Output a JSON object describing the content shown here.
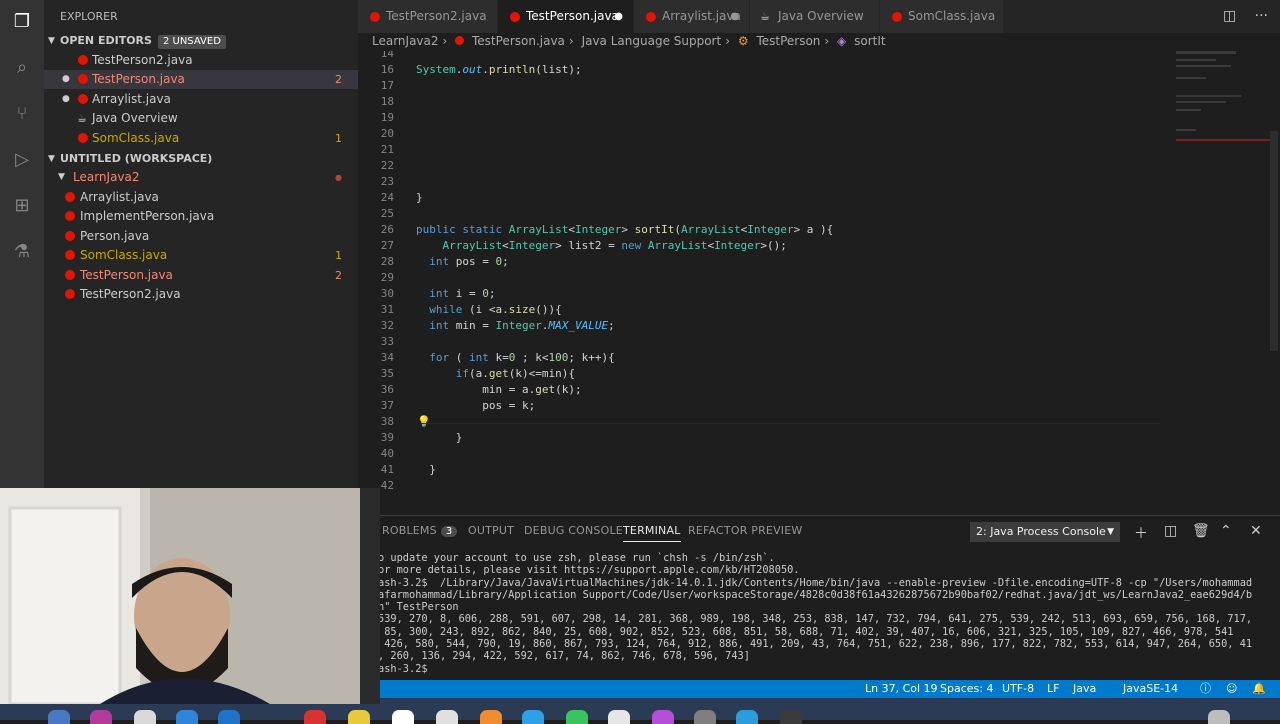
{
  "sidebar": {
    "title": "EXPLORER",
    "open_editors": {
      "label": "OPEN EDITORS",
      "badge": "2 UNSAVED",
      "items": [
        {
          "name": "TestPerson2.java",
          "count": ""
        },
        {
          "name": "TestPerson.java",
          "count": "2"
        },
        {
          "name": "Arraylist.java",
          "count": ""
        },
        {
          "name": "Java Overview",
          "count": ""
        },
        {
          "name": "SomClass.java",
          "count": "1"
        }
      ]
    },
    "workspace": {
      "label": "UNTITLED (WORKSPACE)",
      "folder": "LearnJava2",
      "items": [
        {
          "name": "Arraylist.java",
          "count": ""
        },
        {
          "name": "ImplementPerson.java",
          "count": ""
        },
        {
          "name": "Person.java",
          "count": ""
        },
        {
          "name": "SomClass.java",
          "count": "1"
        },
        {
          "name": "TestPerson.java",
          "count": "2"
        },
        {
          "name": "TestPerson2.java",
          "count": ""
        }
      ]
    }
  },
  "tabs": [
    {
      "label": "TestPerson2.java"
    },
    {
      "label": "TestPerson.java"
    },
    {
      "label": "Arraylist.java"
    },
    {
      "label": "Java Overview"
    },
    {
      "label": "SomClass.java"
    }
  ],
  "breadcrumbs": [
    "LearnJava2",
    "TestPerson.java",
    "Java Language Support",
    "TestPerson",
    "sortIt"
  ],
  "editor": {
    "lines": [
      {
        "n": "14",
        "t": ""
      },
      {
        "n": "16",
        "t": "System.out.println(list);"
      },
      {
        "n": "17",
        "t": ""
      },
      {
        "n": "18",
        "t": ""
      },
      {
        "n": "19",
        "t": ""
      },
      {
        "n": "20",
        "t": ""
      },
      {
        "n": "21",
        "t": ""
      },
      {
        "n": "22",
        "t": ""
      },
      {
        "n": "23",
        "t": ""
      },
      {
        "n": "24",
        "t": "}"
      },
      {
        "n": "25",
        "t": ""
      },
      {
        "n": "26",
        "t": "public static ArrayList<Integer> sortIt(ArrayList<Integer> a ){"
      },
      {
        "n": "27",
        "t": "    ArrayList<Integer> list2 = new ArrayList<Integer>();"
      },
      {
        "n": "28",
        "t": "  int pos = 0;"
      },
      {
        "n": "29",
        "t": ""
      },
      {
        "n": "30",
        "t": "  int i = 0;"
      },
      {
        "n": "31",
        "t": "  while (i <a.size()){"
      },
      {
        "n": "32",
        "t": "  int min = Integer.MAX_VALUE;"
      },
      {
        "n": "33",
        "t": ""
      },
      {
        "n": "34",
        "t": "  for ( int k=0 ; k<100; k++){"
      },
      {
        "n": "35",
        "t": "      if(a.get(k)<=min){"
      },
      {
        "n": "36",
        "t": "          min = a.get(k);"
      },
      {
        "n": "37",
        "t": "          pos = k;"
      },
      {
        "n": "38",
        "t": ""
      },
      {
        "n": "39",
        "t": "      }"
      },
      {
        "n": "40",
        "t": ""
      },
      {
        "n": "41",
        "t": "  }"
      },
      {
        "n": "42",
        "t": ""
      }
    ]
  },
  "panel": {
    "tabs": [
      "ROBLEMS",
      "OUTPUT",
      "DEBUG CONSOLE",
      "TERMINAL",
      "REFACTOR PREVIEW"
    ],
    "problems_count": "3",
    "terminal_select": "2: Java Process Console",
    "terminal_lines": [
      "o update your account to use zsh, please run `chsh -s /bin/zsh`.",
      "or more details, please visit https://support.apple.com/kb/HT208050.",
      "ash-3.2$  /Library/Java/JavaVirtualMachines/jdk-14.0.1.jdk/Contents/Home/bin/java --enable-preview -Dfile.encoding=UTF-8 -cp \"/Users/mohammad",
      "afarmohammad/Library/Application Support/Code/User/workspaceStorage/4828c0d38f61a43262875672b90baf02/redhat.java/jdt_ws/LearnJava2_eae629d4/b",
      "n\" TestPerson",
      "539, 270, 8, 606, 288, 591, 607, 298, 14, 281, 368, 989, 198, 348, 253, 838, 147, 732, 794, 641, 275, 539, 242, 513, 693, 659, 756, 168, 717,",
      " 85, 300, 243, 892, 862, 840, 25, 608, 902, 852, 523, 608, 851, 58, 688, 71, 402, 39, 407, 16, 606, 321, 325, 105, 109, 827, 466, 978, 541",
      " 426, 580, 544, 790, 19, 860, 867, 793, 124, 764, 912, 886, 491, 209, 43, 764, 751, 622, 238, 896, 177, 822, 782, 553, 614, 947, 264, 650, 41",
      ", 260, 136, 294, 422, 592, 617, 74, 862, 746, 678, 596, 743]",
      "ash-3.2$ "
    ]
  },
  "statusbar": {
    "position": "Ln 37, Col 19",
    "spaces": "Spaces: 4",
    "encoding": "UTF-8",
    "eol": "LF",
    "language": "Java",
    "runtime": "JavaSE-14"
  },
  "colors": {
    "accent": "#007acc",
    "error": "#e51400",
    "warning": "#cca700",
    "background": "#1e1e1e"
  }
}
